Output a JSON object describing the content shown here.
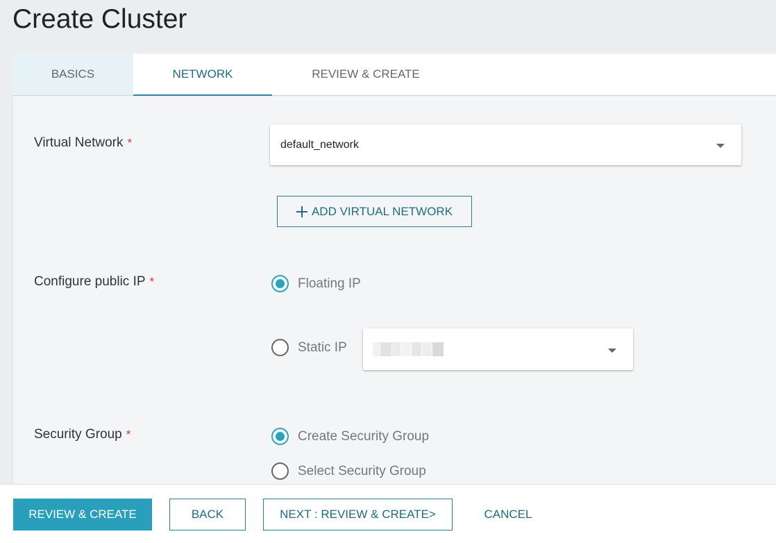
{
  "page": {
    "title": "Create Cluster"
  },
  "tabs": [
    {
      "label": "BASICS"
    },
    {
      "label": "NETWORK"
    },
    {
      "label": "REVIEW & CREATE"
    }
  ],
  "form": {
    "virtual_network": {
      "label": "Virtual Network",
      "required_mark": "*",
      "value": "default_network",
      "add_button_label": "ADD VIRTUAL NETWORK"
    },
    "public_ip": {
      "label": "Configure public IP",
      "required_mark": "*",
      "options": [
        {
          "label": "Floating IP",
          "checked": true
        },
        {
          "label": "Static IP",
          "checked": false
        }
      ]
    },
    "security_group": {
      "label": "Security Group",
      "required_mark": "*",
      "options": [
        {
          "label": "Create Security Group",
          "checked": true
        },
        {
          "label": "Select Security Group",
          "checked": false
        }
      ]
    }
  },
  "footer": {
    "review_create_label": "REVIEW & CREATE",
    "back_label": "BACK",
    "next_label": "NEXT : REVIEW & CREATE>",
    "cancel_label": "CANCEL"
  },
  "colors": {
    "accent": "#2a9fbb",
    "accent_text": "#1f6b80",
    "required": "#d9343a",
    "active_tab_bg": "#e6f2f6"
  },
  "icons": [
    "plus-icon",
    "chevron-down-icon",
    "radio-checked-icon",
    "radio-unchecked-icon"
  ]
}
